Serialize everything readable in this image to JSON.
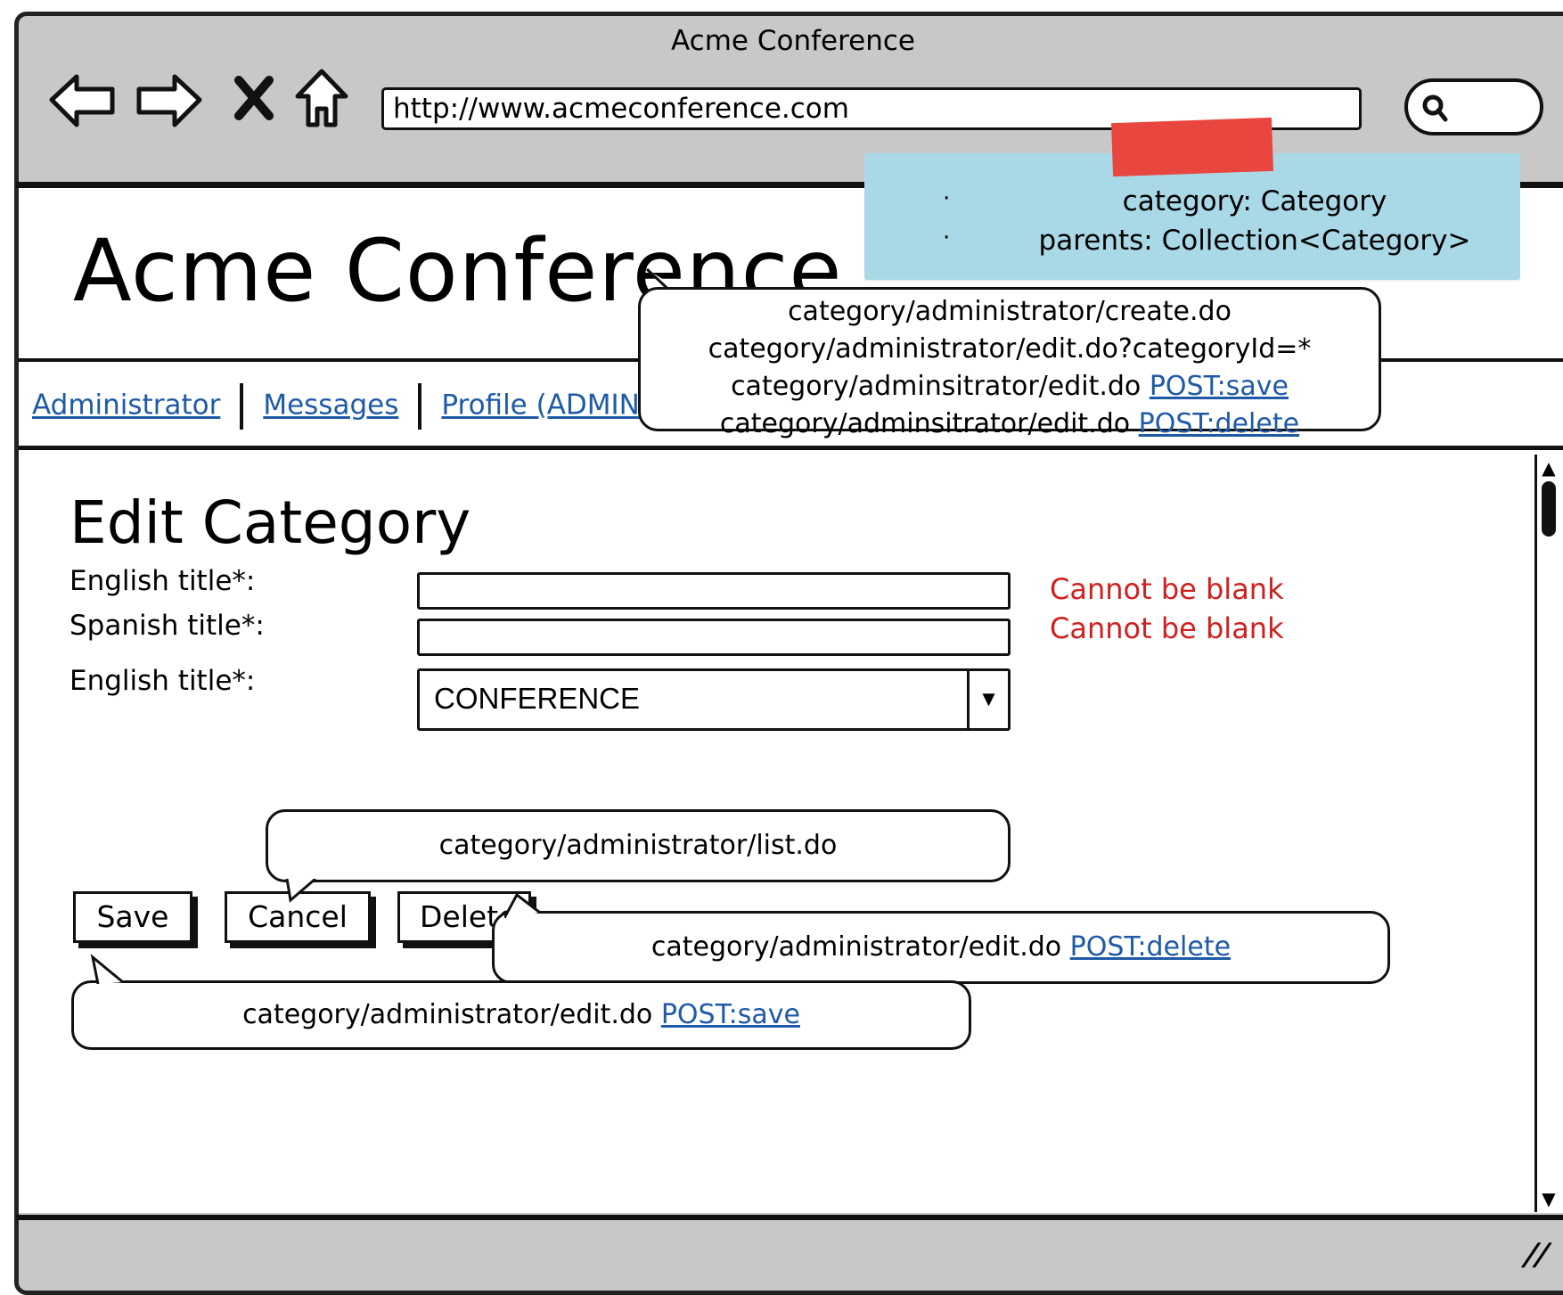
{
  "browser": {
    "title": "Acme Conference",
    "url": "http://www.acmeconference.com"
  },
  "site": {
    "title": "Acme Conference"
  },
  "menu": {
    "items": [
      "Administrator",
      "Messages",
      "Profile (ADMIN"
    ]
  },
  "page": {
    "heading": "Edit Category"
  },
  "form": {
    "english_title_label": "English title*:",
    "spanish_title_label": "Spanish title*:",
    "parent_label": "English title*:",
    "english_title_value": "",
    "spanish_title_value": "",
    "english_error": "Cannot be blank",
    "spanish_error": "Cannot be blank",
    "parent_selected": "CONFERENCE"
  },
  "buttons": {
    "save": "Save",
    "cancel": "Cancel",
    "delete": "Delete"
  },
  "sticky_note": {
    "lines": [
      "category: Category",
      "parents: Collection<Category>"
    ],
    "bullet": "·"
  },
  "callouts": {
    "top": {
      "line1": "category/administrator/create.do",
      "line2": "category/administrator/edit.do?categoryId=*",
      "line3_text": "category/adminsitrator/edit.do ",
      "line3_link": "POST:save",
      "line4_text": "category/adminsitrator/edit.do ",
      "line4_link": "POST:delete"
    },
    "cancel": {
      "text": "category/administrator/list.do"
    },
    "delete": {
      "text": "category/administrator/edit.do ",
      "link": "POST:delete"
    },
    "save": {
      "text": "category/administrator/edit.do ",
      "link": "POST:save"
    }
  },
  "colors": {
    "link": "#1e5aa8",
    "error": "#d02020",
    "sticky": "#a9d8e6",
    "tape": "#e8463f",
    "chrome": "#c8c8c8"
  }
}
